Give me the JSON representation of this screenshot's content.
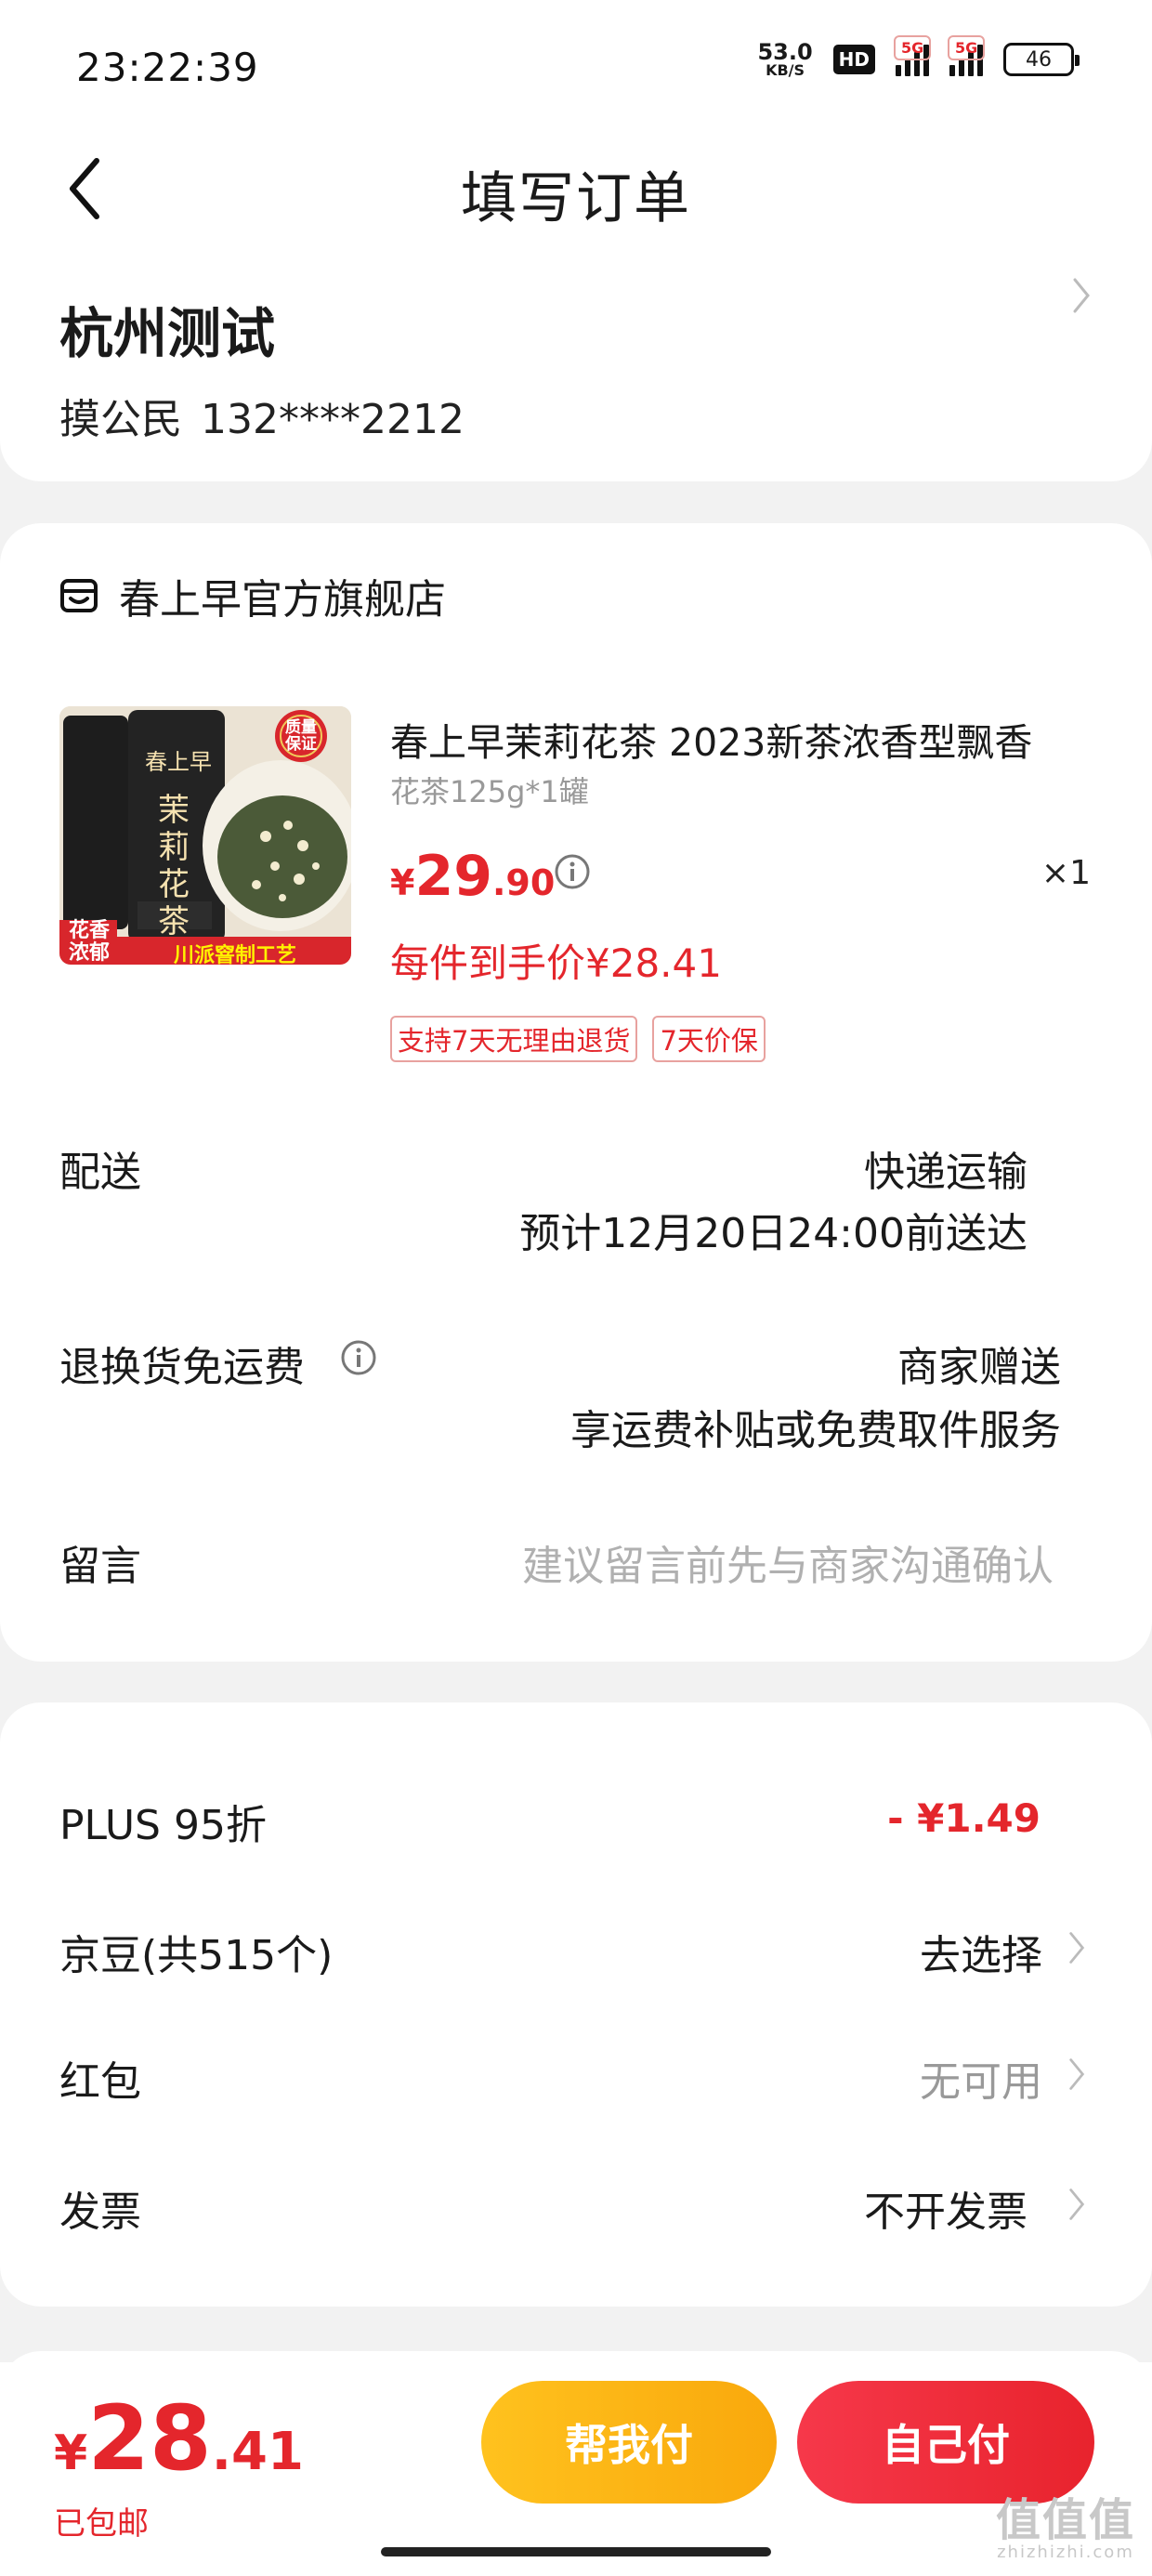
{
  "status_bar": {
    "time": "23:22:39",
    "net_speed_value": "53.0",
    "net_speed_unit": "KB/S",
    "hd_label": "HD",
    "sim1_label": "5G",
    "sim2_label": "5G",
    "battery": "46"
  },
  "nav": {
    "title": "填写订单",
    "back_icon": "chevron-left-icon"
  },
  "address": {
    "title": "杭州测试",
    "name": "摸公民",
    "phone": "132****2212"
  },
  "store": {
    "name": "春上早官方旗舰店",
    "icon": "store-icon"
  },
  "product": {
    "title": "春上早茉莉花茶 2023新茶浓香型飘香",
    "spec": "花茶125g*1罐",
    "price_symbol": "¥",
    "price_int": "29",
    "price_dec": ".90",
    "quantity": "×1",
    "net_price": "每件到手价¥28.41",
    "tags": [
      "支持7天无理由退货",
      "7天价保"
    ],
    "image": {
      "brand": "春上早",
      "name": "茉莉花茶",
      "seal": "质量保证",
      "badge_left": "花香浓郁",
      "badge_bottom": "川派窨制工艺"
    }
  },
  "delivery": {
    "label": "配送",
    "method": "快递运输",
    "eta": "预计12月20日24:00前送达"
  },
  "return_shipping": {
    "label": "退换货免运费",
    "value": "商家赠送",
    "detail": "享运费补贴或免费取件服务"
  },
  "message": {
    "label": "留言",
    "placeholder": "建议留言前先与商家沟通确认"
  },
  "discounts": {
    "plus": {
      "label": "PLUS 95折",
      "value": "- ¥1.49"
    },
    "jingdou": {
      "label": "京豆(共515个)",
      "value": "去选择"
    },
    "hongbao": {
      "label": "红包",
      "value": "无可用"
    },
    "invoice": {
      "label": "发票",
      "value": "不开发票"
    }
  },
  "footer": {
    "total_symbol": "¥",
    "total_int": "28",
    "total_dec": ".41",
    "shipping_note": "已包邮",
    "help_pay": "帮我付",
    "self_pay": "自己付"
  },
  "watermark": {
    "main": "值值值",
    "sub": "zhizhizhi.com"
  },
  "colors": {
    "accent_red": "#e4262c",
    "help_btn": "#ffc21e",
    "self_btn": "#f6384a"
  }
}
